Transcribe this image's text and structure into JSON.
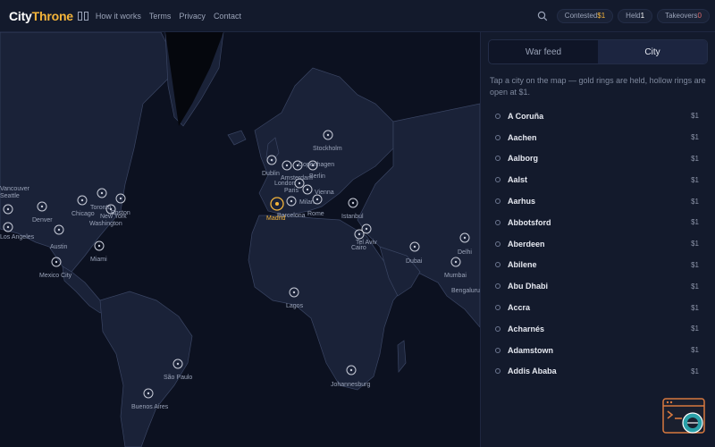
{
  "brand": {
    "part1": "City",
    "part2": "Throne"
  },
  "nav": [
    "How it works",
    "Terms",
    "Privacy",
    "Contact"
  ],
  "stats": {
    "contested_label": "Contested",
    "contested_value": "$1",
    "held_label": "Held",
    "held_value": "1",
    "takeovers_label": "Takeovers",
    "takeovers_value": "0"
  },
  "tabs": {
    "war_feed": "War feed",
    "city": "City"
  },
  "hint": "Tap a city on the map — gold rings are held, hollow rings are open at $1.",
  "cities": [
    {
      "name": "A Coruña",
      "price": "$1"
    },
    {
      "name": "Aachen",
      "price": "$1"
    },
    {
      "name": "Aalborg",
      "price": "$1"
    },
    {
      "name": "Aalst",
      "price": "$1"
    },
    {
      "name": "Aarhus",
      "price": "$1"
    },
    {
      "name": "Abbotsford",
      "price": "$1"
    },
    {
      "name": "Aberdeen",
      "price": "$1"
    },
    {
      "name": "Abilene",
      "price": "$1"
    },
    {
      "name": "Abu Dhabi",
      "price": "$1"
    },
    {
      "name": "Accra",
      "price": "$1"
    },
    {
      "name": "Acharnés",
      "price": "$1"
    },
    {
      "name": "Adamstown",
      "price": "$1"
    },
    {
      "name": "Addis Ababa",
      "price": "$1"
    }
  ],
  "map_labels": [
    "Vancouver",
    "Seattle",
    "Los Angeles",
    "Denver",
    "Chicago",
    "Toronto",
    "Boston",
    "New York",
    "Washington",
    "Austin",
    "Miami",
    "Mexico City",
    "Dublin",
    "Stockholm",
    "Copenhagen",
    "Amsterdam",
    "London",
    "Paris",
    "Berlin",
    "Vienna",
    "Milan",
    "Rome",
    "Barcelona",
    "Madrid",
    "Istanbul",
    "Tel Aviv",
    "Cairo",
    "Dubai",
    "Delhi",
    "Mumbai",
    "Bengaluru",
    "Lagos",
    "Johannesburg",
    "São Paulo",
    "Buenos Aires"
  ],
  "colors": {
    "gold": "#f4b43a",
    "bg": "#0d1224",
    "panel": "#131a2c"
  }
}
